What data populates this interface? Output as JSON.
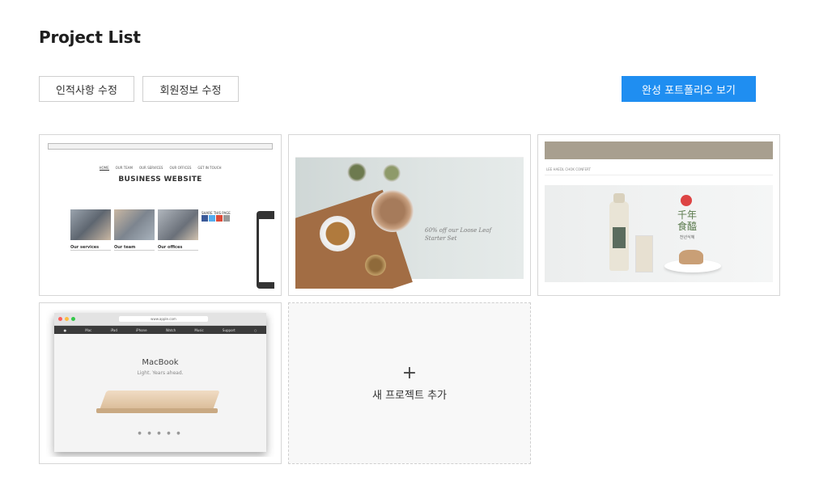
{
  "page": {
    "title": "Project List"
  },
  "toolbar": {
    "edit_profile_info": "인적사항 수정",
    "edit_member_info": "회원정보 수정",
    "view_portfolio": "완성 포트폴리오 보기"
  },
  "projects": [
    {
      "heading": "BUSINESS WEBSITE",
      "nav": [
        "HOME",
        "OUR TEAM",
        "OUR SERVICES",
        "OUR OFFICES",
        "GET IN TOUCH"
      ],
      "columns": [
        "Our services",
        "Our team",
        "Our offices"
      ],
      "share": "SHARE THIS PAGE"
    },
    {
      "copy_line1": "60% off our Loose Leaf",
      "copy_line2": "Starter Set"
    },
    {
      "brand": "LEE HAEDL CHOK CONFERT",
      "kor_title": "千年\n食醯",
      "kor_sub": "천년식혜"
    },
    {
      "url": "www.apple.com",
      "nav": [
        "Mac",
        "iPad",
        "iPhone",
        "Watch",
        "Music",
        "Support"
      ],
      "title": "MacBook",
      "tagline": "Light. Years ahead."
    }
  ],
  "new_project": {
    "plus": "+",
    "label": "새 프로젝트 추가"
  },
  "colors": {
    "primary": "#1f8ef1",
    "border": "#d6d6d6"
  }
}
